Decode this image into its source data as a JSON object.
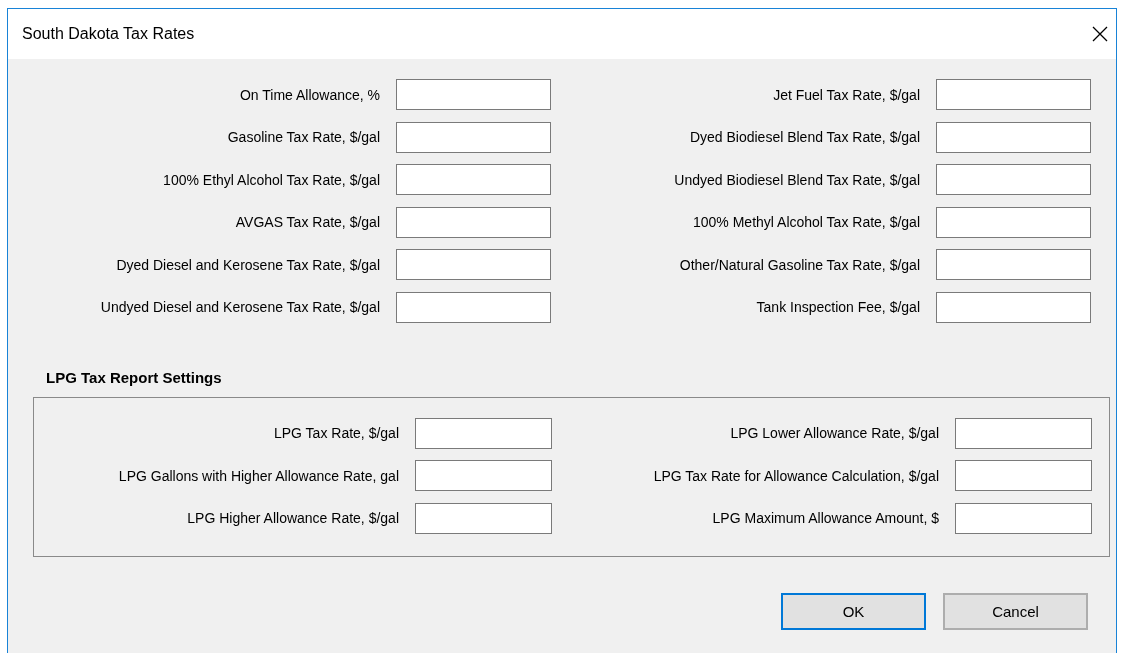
{
  "window": {
    "title": "South Dakota Tax Rates"
  },
  "tax_rates": {
    "left": [
      {
        "label": "On Time Allowance, %"
      },
      {
        "label": "Gasoline Tax Rate, $/gal"
      },
      {
        "label": "100% Ethyl Alcohol Tax Rate, $/gal"
      },
      {
        "label": "AVGAS Tax Rate, $/gal"
      },
      {
        "label": "Dyed Diesel and Kerosene Tax Rate, $/gal"
      },
      {
        "label": "Undyed Diesel and Kerosene Tax Rate, $/gal"
      }
    ],
    "right": [
      {
        "label": "Jet Fuel Tax Rate, $/gal"
      },
      {
        "label": "Dyed Biodiesel Blend Tax Rate, $/gal"
      },
      {
        "label": "Undyed Biodiesel Blend Tax Rate, $/gal"
      },
      {
        "label": "100% Methyl Alcohol Tax Rate, $/gal"
      },
      {
        "label": "Other/Natural Gasoline Tax Rate, $/gal"
      },
      {
        "label": "Tank Inspection Fee, $/gal"
      }
    ]
  },
  "lpg_settings": {
    "title": "LPG Tax Report Settings",
    "left": [
      {
        "label": "LPG Tax Rate, $/gal"
      },
      {
        "label": "LPG Gallons with Higher Allowance Rate, gal"
      },
      {
        "label": "LPG Higher Allowance Rate, $/gal"
      }
    ],
    "right": [
      {
        "label": "LPG Lower Allowance Rate, $/gal"
      },
      {
        "label": "LPG Tax Rate for Allowance Calculation, $/gal"
      },
      {
        "label": "LPG Maximum Allowance Amount, $"
      }
    ]
  },
  "buttons": [
    {
      "label": "OK",
      "default": true
    },
    {
      "label": "Cancel",
      "default": false
    }
  ]
}
